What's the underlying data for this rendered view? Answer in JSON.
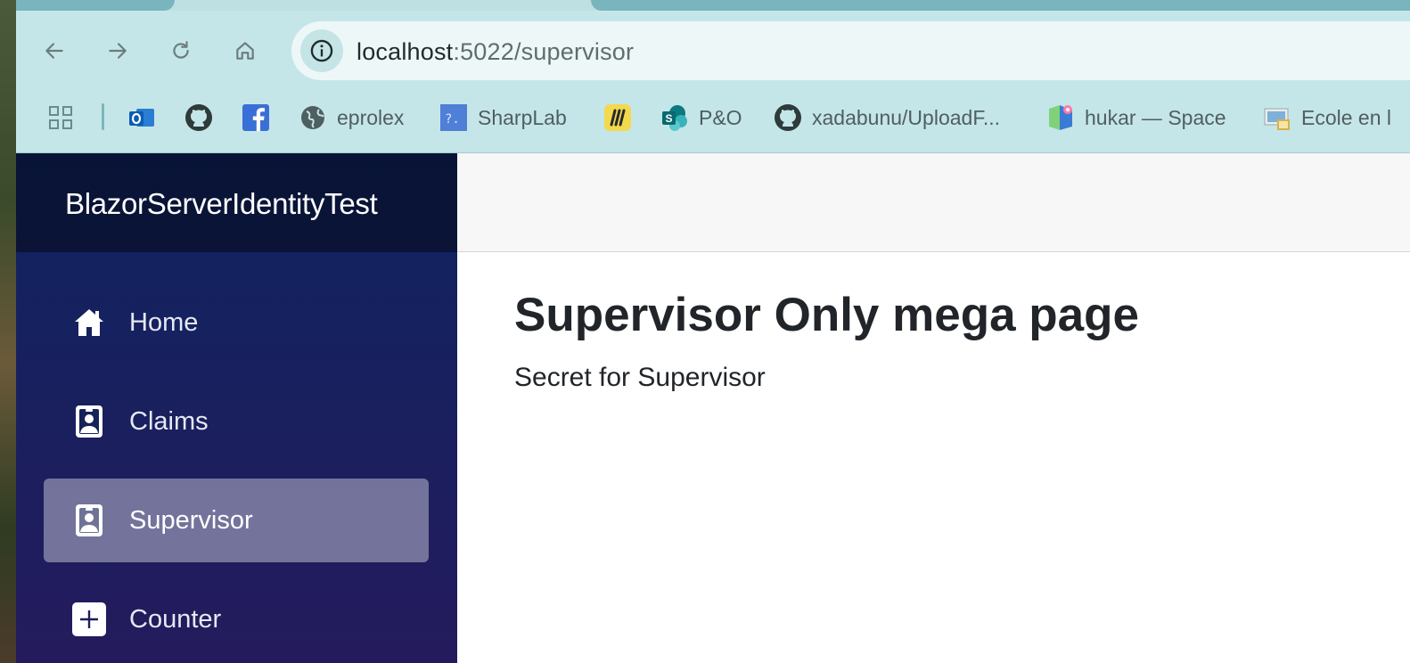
{
  "browser": {
    "url_host": "localhost",
    "url_path": ":5022/supervisor",
    "bookmarks": [
      {
        "icon": "apps-grid-icon",
        "label": ""
      },
      {
        "icon": "outlook-icon",
        "label": ""
      },
      {
        "icon": "github-icon",
        "label": ""
      },
      {
        "icon": "facebook-icon",
        "label": ""
      },
      {
        "icon": "globe-icon",
        "label": "eprolex"
      },
      {
        "icon": "sharplab-icon",
        "label": "SharpLab"
      },
      {
        "icon": "miro-icon",
        "label": ""
      },
      {
        "icon": "sharepoint-icon",
        "label": "P&O"
      },
      {
        "icon": "github-icon",
        "label": "xadabunu/UploadF..."
      },
      {
        "icon": "space-icon",
        "label": "hukar — Space"
      },
      {
        "icon": "school-icon",
        "label": "Ecole en l"
      }
    ]
  },
  "app": {
    "brand": "BlazorServerIdentityTest",
    "nav": [
      {
        "label": "Home",
        "icon": "home-icon",
        "active": false
      },
      {
        "label": "Claims",
        "icon": "badge-icon",
        "active": false
      },
      {
        "label": "Supervisor",
        "icon": "badge-icon",
        "active": true
      },
      {
        "label": "Counter",
        "icon": "plus-square-icon",
        "active": false
      }
    ]
  },
  "main": {
    "title": "Supervisor Only mega page",
    "text": "Secret for Supervisor"
  },
  "colors": {
    "browser_chrome": "#c5e6e8",
    "sidebar_top": "#0f2460",
    "sidebar_bottom": "#241b5d",
    "active_item": "rgba(255,255,255,0.38)"
  }
}
